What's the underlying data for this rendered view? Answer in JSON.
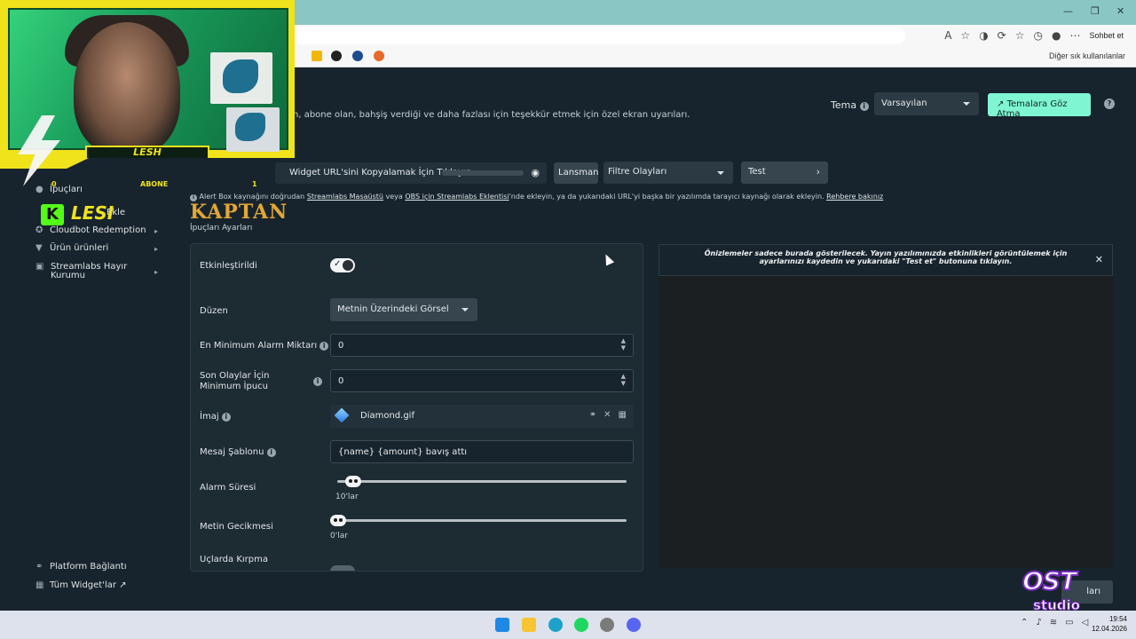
{
  "browser": {
    "chat_label": "Sohbet et",
    "other_bookmarks": "Diğer sık kullanılanlar"
  },
  "header": {
    "description": "n, abone olan, bahşiş verdiği ve daha fazlası için teşekkür etmek için özel ekran uyarıları.",
    "theme_label": "Tema",
    "theme_value": "Varsayılan",
    "browse_themes": "Temalara Göz Atma"
  },
  "toolbar": {
    "widget_url_label": "Widget URL'sini Kopyalamak İçin Tıklayın",
    "launch": "Lansman",
    "filter_events": "Filtre Olayları",
    "test": "Test",
    "note_prefix": "Alert Box kaynağını doğrudan ",
    "note_link1": "Streamlabs Masaüstü",
    "note_mid1": " veya ",
    "note_link2": "OBS için Streamlabs Eklentisi",
    "note_mid2": "'nde ekleyin, ya da yukarıdaki URL'yi başka bir yazılımda tarayıcı kaynağı olarak ekleyin. ",
    "note_link3": "Rehbere bakınız"
  },
  "sidebar": {
    "items": [
      {
        "label": "İpuçları"
      },
      {
        "label": "Ekle"
      },
      {
        "label": "Cloudbot Redemption"
      },
      {
        "label": "Ürün ürünleri"
      },
      {
        "label": "Streamlabs Hayır Kurumu"
      }
    ],
    "footer": [
      {
        "label": "Platform Bağlantı"
      },
      {
        "label": "Tüm Widget'lar"
      }
    ]
  },
  "section": {
    "tab_title": "İpuçları Ayarları",
    "logo_text": "KAPTAN"
  },
  "form": {
    "enabled_label": "Etkinleştirildi",
    "layout_label": "Düzen",
    "layout_value": "Metnin Üzerindeki Görsel",
    "min_amount_label": "En Minimum Alarm Miktarı",
    "min_amount_value": "0",
    "recent_min_label": "Son Olaylar İçin Minimum İpucu",
    "recent_min_value": "0",
    "image_label": "İmaj",
    "image_value": "Diamond.gif",
    "message_label": "Mesaj Şablonu",
    "message_value": "{name} {amount} bavış attı",
    "duration_label": "Alarm Süresi",
    "duration_value": "10'lar",
    "duration_level": 0.03,
    "text_delay_label": "Metin Gecikmesi",
    "text_delay_value": "0'lar",
    "text_delay_level": 0.0,
    "crop_label": "Uçlarda Kırpma"
  },
  "preview": {
    "notice": "Önizlemeler sadece burada gösterilecek. Yayın yazılımınızda etkinlikleri görüntülemek için ayarlarınızı kaydedin ve yukarıdaki \"Test et\" butonuna tıklayın."
  },
  "bottom_button": "ları",
  "overlay": {
    "cam_name": "LESH",
    "abone_label": "ABONE",
    "abone_left": "0",
    "abone_right": "1",
    "kick_letter": "K",
    "kick_name": "LESI",
    "watermark_top": "OST",
    "watermark_bottom": "studio"
  },
  "clock": {
    "time": "19:54",
    "date": "12.04.2026"
  },
  "colors": {
    "accent": "#80f5d2",
    "background": "#17242d",
    "overlay_yellow": "#f0e21b"
  }
}
